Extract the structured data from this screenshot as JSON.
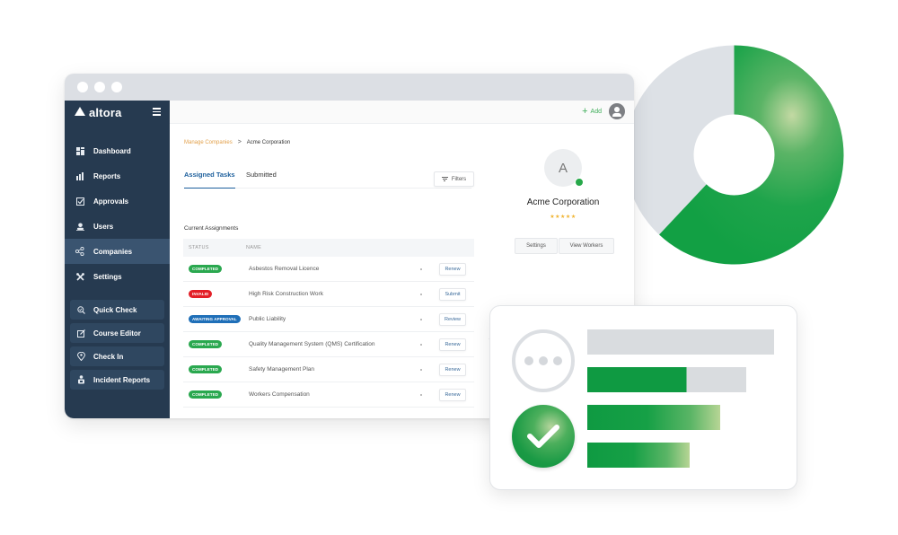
{
  "window": {
    "brand": "altora",
    "header": {
      "add_label": "Add",
      "add_icon": "plus-icon",
      "user_icon": "user-avatar-icon"
    }
  },
  "sidebar": {
    "items": [
      {
        "label": "Dashboard",
        "icon": "dashboard-icon",
        "active": false
      },
      {
        "label": "Reports",
        "icon": "bar-chart-icon",
        "active": false
      },
      {
        "label": "Approvals",
        "icon": "checkbox-icon",
        "active": false
      },
      {
        "label": "Users",
        "icon": "user-icon",
        "active": false
      },
      {
        "label": "Companies",
        "icon": "share-nodes-icon",
        "active": true
      },
      {
        "label": "Settings",
        "icon": "tools-icon",
        "active": false
      }
    ],
    "quick_actions": [
      {
        "label": "Quick Check",
        "icon": "search-check-icon"
      },
      {
        "label": "Course Editor",
        "icon": "edit-icon"
      },
      {
        "label": "Check In",
        "icon": "location-pin-icon"
      },
      {
        "label": "Incident Reports",
        "icon": "report-person-icon"
      }
    ]
  },
  "breadcrumb": {
    "parent": "Manage Companies",
    "separator": ">",
    "current": "Acme Corporation"
  },
  "tabs": [
    {
      "label": "Assigned Tasks",
      "active": true
    },
    {
      "label": "Submitted",
      "active": false
    }
  ],
  "filters_label": "Filters",
  "assignments": {
    "title": "Current Assignments",
    "columns": [
      "STATUS",
      "NAME"
    ],
    "rows": [
      {
        "status": "COMPLETED",
        "status_color": "#2aa84f",
        "name": "Asbestos Removal Licence",
        "action": "Renew"
      },
      {
        "status": "INVALID",
        "status_color": "#e32028",
        "name": "High Risk Construction Work",
        "action": "Submit"
      },
      {
        "status": "AWAITING APPROVAL",
        "status_color": "#1f6fb8",
        "name": "Public Liability",
        "action": "Review"
      },
      {
        "status": "COMPLETED",
        "status_color": "#2aa84f",
        "name": "Quality Management System (QMS) Certification",
        "action": "Renew"
      },
      {
        "status": "COMPLETED",
        "status_color": "#2aa84f",
        "name": "Safety Management Plan",
        "action": "Renew"
      },
      {
        "status": "COMPLETED",
        "status_color": "#2aa84f",
        "name": "Workers Compensation",
        "action": "Renew"
      }
    ]
  },
  "profile": {
    "initial": "A",
    "name": "Acme Corporation",
    "rating_stars": 5,
    "stars_text": "★★★★★",
    "buttons": [
      "Settings",
      "View Workers"
    ]
  },
  "decor": {
    "donut": {
      "green_fraction": 0.62,
      "colors": {
        "green": "#16a34a",
        "gray": "#dde1e6"
      }
    },
    "status_card": {
      "bars": [
        {
          "fill_fraction": 0.0,
          "track_fraction": 1.0,
          "style": "gray"
        },
        {
          "fill_fraction": 0.53,
          "track_fraction": 0.85,
          "style": "split"
        },
        {
          "fill_fraction": 0.71,
          "track_fraction": 0.71,
          "style": "gradient"
        },
        {
          "fill_fraction": 0.55,
          "track_fraction": 0.55,
          "style": "gradient"
        }
      ]
    }
  },
  "colors": {
    "sidebar_bg": "#263a50",
    "sidebar_active": "#3a5470",
    "accent_blue": "#1d5f9c",
    "breadcrumb_link": "#e2a04a",
    "brand_green": "#27a84a"
  }
}
